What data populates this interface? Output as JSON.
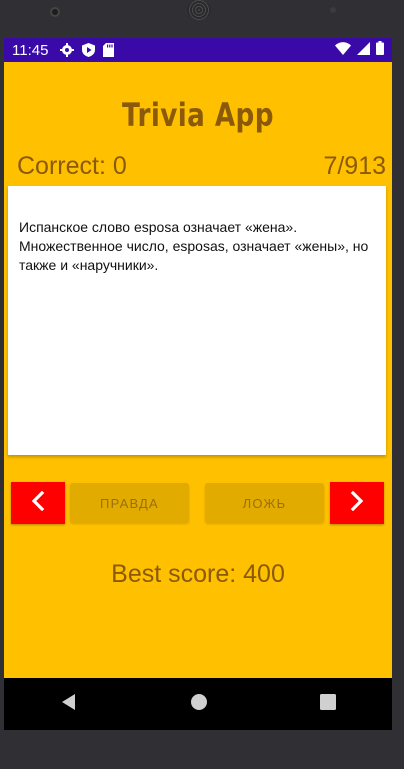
{
  "status_bar": {
    "time": "11:45",
    "icons": [
      "gear-icon",
      "play-protect-icon",
      "sd-card-icon"
    ],
    "right_icons": [
      "wifi-icon",
      "signal-icon",
      "battery-icon"
    ]
  },
  "app": {
    "title": "Trivia App",
    "correct_label": "Correct: 0",
    "progress_label": "7/913",
    "question_text": "Испанское слово esposa означает «жена». Множественное число, esposas, означает «жены», но также и «наручники».",
    "true_button": "ПРАВДА",
    "false_button": "ЛОЖЬ",
    "best_score_label": "Best score: 400"
  },
  "nav_buttons": {
    "prev": "chevron-left-icon",
    "next": "chevron-right-icon"
  },
  "system_nav": [
    "back-icon",
    "home-icon",
    "recents-icon"
  ],
  "colors": {
    "status_bar": "#3a0aa8",
    "background": "#ffc000",
    "text": "#8a5a08",
    "nav_button": "#ff0000",
    "answer_button": "#e2ab00"
  }
}
